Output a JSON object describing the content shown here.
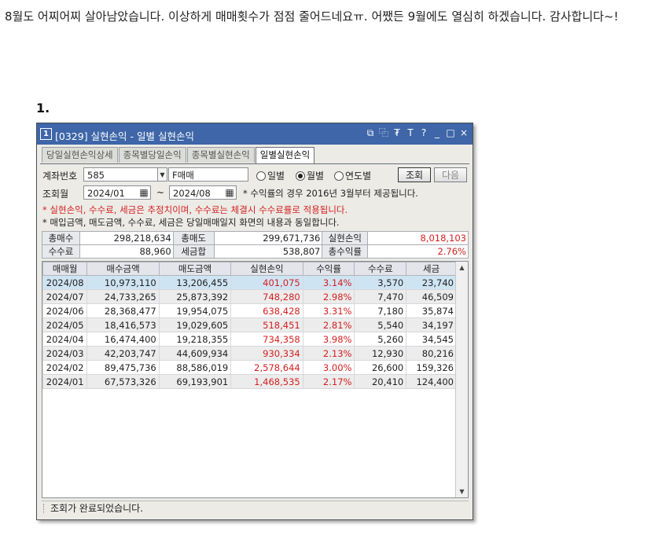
{
  "post": {
    "text": "8월도 어찌어찌 살아남았습니다. 이상하게 매매횟수가 점점 줄어드네요ㅠ. 어쨌든 9월에도 열심히 하겠습니다. 감사합니다~!",
    "list_number": "1."
  },
  "window": {
    "badge": "1",
    "title": "[0329] 실현손익 - 일별 실현손익",
    "icons": [
      "link-icon",
      "copy-icon",
      "pin-icon",
      "text-icon",
      "help-icon",
      "minimize-icon",
      "maximize-icon",
      "close-icon"
    ],
    "icon_glyphs": [
      "⧉",
      "⿻",
      "₮",
      "T",
      "?",
      "_",
      "□",
      "×"
    ]
  },
  "tabs": [
    {
      "label": "당일실현손익상세",
      "active": false
    },
    {
      "label": "종목별당일손익",
      "active": false
    },
    {
      "label": "종목별실현손익",
      "active": false
    },
    {
      "label": "일별실현손익",
      "active": true
    }
  ],
  "form": {
    "account_label": "계좌번호",
    "account_value": "585",
    "account_type": "F매매",
    "period_options": [
      "일별",
      "월별",
      "연도별"
    ],
    "period_selected": "월별",
    "query_button": "조회",
    "next_button": "다음",
    "date_label": "조회월",
    "date_from": "2024/01",
    "date_sep": "~",
    "date_to": "2024/08",
    "date_note": "* 수익률의 경우 2016년 3월부터 제공됩니다."
  },
  "notes": {
    "red": "* 실현손익, 수수료, 세금은 추정치이며, 수수료는 체결시 수수료률로 적용됩니다.",
    "black": "* 매입금액, 매도금액, 수수료, 세금은 당일매매일지 화면의 내용과 동일합니다."
  },
  "summary": {
    "row1": [
      {
        "label": "총매수",
        "value": "298,218,634"
      },
      {
        "label": "총매도",
        "value": "299,671,736"
      },
      {
        "label": "실현손익",
        "value": "8,018,103"
      }
    ],
    "row2": [
      {
        "label": "수수료",
        "value": "88,960"
      },
      {
        "label": "세금합",
        "value": "538,807"
      },
      {
        "label": "총수익률",
        "value": "2.76%"
      }
    ]
  },
  "grid": {
    "columns": [
      "매매월",
      "매수금액",
      "매도금액",
      "실현손익",
      "수익률",
      "수수료",
      "세금"
    ],
    "rows": [
      [
        "2024/08",
        "10,973,110",
        "13,206,455",
        "401,075",
        "3.14%",
        "3,570",
        "23,740"
      ],
      [
        "2024/07",
        "24,733,265",
        "25,873,392",
        "748,280",
        "2.98%",
        "7,470",
        "46,509"
      ],
      [
        "2024/06",
        "28,368,477",
        "19,954,075",
        "638,428",
        "3.31%",
        "7,180",
        "35,874"
      ],
      [
        "2024/05",
        "18,416,573",
        "19,029,605",
        "518,451",
        "2.81%",
        "5,540",
        "34,197"
      ],
      [
        "2024/04",
        "16,474,400",
        "19,218,355",
        "734,358",
        "3.98%",
        "5,260",
        "34,545"
      ],
      [
        "2024/03",
        "42,203,747",
        "44,609,934",
        "930,334",
        "2.13%",
        "12,930",
        "80,216"
      ],
      [
        "2024/02",
        "89,475,736",
        "88,586,019",
        "2,578,644",
        "3.00%",
        "26,600",
        "159,326"
      ],
      [
        "2024/01",
        "67,573,326",
        "69,193,901",
        "1,468,535",
        "2.17%",
        "20,410",
        "124,400"
      ]
    ]
  },
  "status": {
    "text": "조회가 완료되었습니다."
  },
  "colors": {
    "titlebar": "#3e66a8",
    "profit_red": "#d42020",
    "selected_row": "#cfe4f3"
  }
}
